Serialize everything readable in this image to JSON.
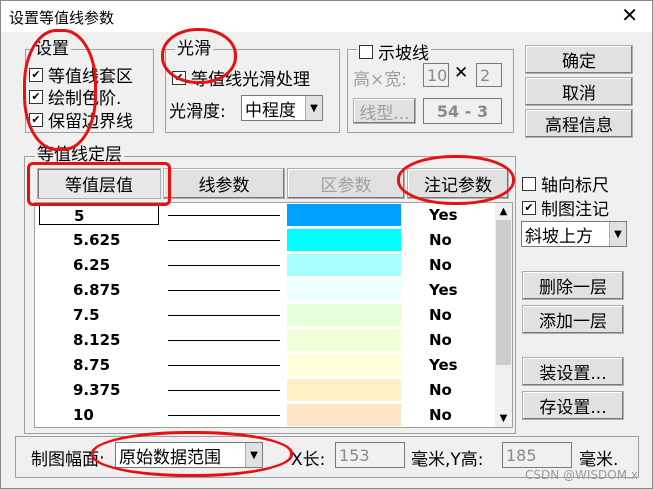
{
  "window": {
    "title": "设置等值线参数",
    "close_glyph": "✕"
  },
  "settings_group": {
    "legend": "设置",
    "items": [
      {
        "label": "等值线套区",
        "checked": true
      },
      {
        "label": "绘制色阶.",
        "checked": true
      },
      {
        "label": "保留边界线",
        "checked": true
      }
    ]
  },
  "smooth_group": {
    "legend": "光滑",
    "checkbox_label": "等值线光滑处理",
    "checked": true,
    "degree_label": "光滑度:",
    "degree_value": "中程度"
  },
  "slope_group": {
    "legend": "示坡线",
    "checked": false,
    "size_label": "高×宽:",
    "height": "10",
    "times": "✕",
    "width": "2",
    "line_type_button": "线型...",
    "line_type_value": "54 - 3"
  },
  "right_buttons": {
    "ok": "确定",
    "cancel": "取消",
    "elevation": "高程信息"
  },
  "layer_group": {
    "legend": "等值线定层",
    "tabs": [
      "等值层值",
      "线参数",
      "区参数",
      "注记参数"
    ],
    "rows": [
      {
        "value": "5",
        "color": "#00a0ff",
        "note": "Yes"
      },
      {
        "value": "5.625",
        "color": "#00ffff",
        "note": "No"
      },
      {
        "value": "6.25",
        "color": "#a8ffff",
        "note": "No"
      },
      {
        "value": "6.875",
        "color": "#ecffff",
        "note": "Yes"
      },
      {
        "value": "7.5",
        "color": "#e6ffd8",
        "note": "No"
      },
      {
        "value": "8.125",
        "color": "#f0ffd8",
        "note": "No"
      },
      {
        "value": "8.75",
        "color": "#ffffd8",
        "note": "Yes"
      },
      {
        "value": "9.375",
        "color": "#fff0c8",
        "note": "No"
      },
      {
        "value": "10",
        "color": "#ffe4c8",
        "note": "No"
      }
    ]
  },
  "side_panel": {
    "axis_ruler_label": "轴向标尺",
    "axis_ruler_checked": false,
    "map_note_label": "制图注记",
    "map_note_checked": true,
    "direction_value": "斜坡上方",
    "delete_layer": "删除一层",
    "add_layer": "添加一层",
    "load_settings": "装设置...",
    "save_settings": "存设置..."
  },
  "bottom": {
    "extent_label": "制图幅面:",
    "extent_value": "原始数据范围",
    "x_label": "X长:",
    "x_value": "153",
    "mm_y_label": "毫米,Y高:",
    "y_value": "185",
    "mm_label": "毫米."
  },
  "watermark": "CSDN @WISDOM.x",
  "icons": {
    "check": "✔",
    "arrow_down": "▼",
    "arrow_up": "▲"
  }
}
